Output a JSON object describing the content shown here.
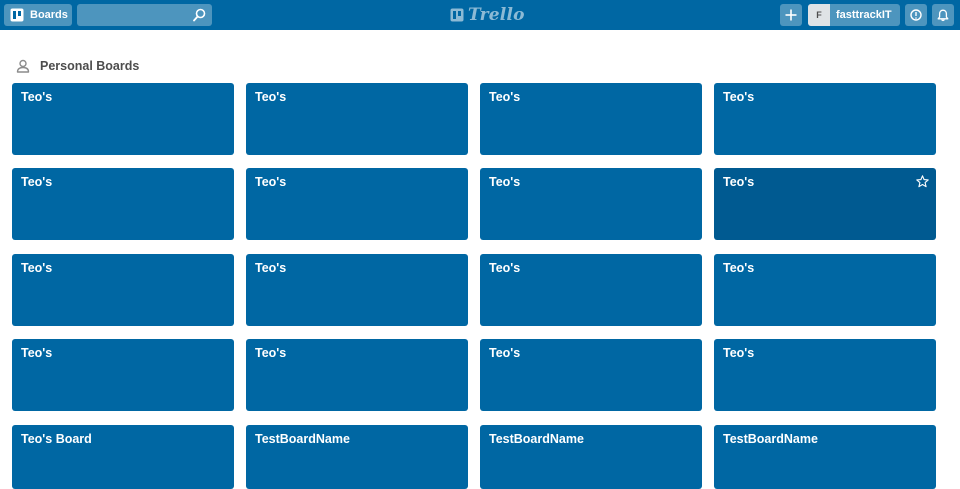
{
  "header": {
    "boards_label": "Boards",
    "search": {
      "value": "",
      "placeholder": ""
    },
    "logo_text": "Trello",
    "member": {
      "initial": "F",
      "name": "fasttrackIT"
    }
  },
  "section": {
    "title": "Personal Boards"
  },
  "boards": [
    "Teo's",
    "Teo's",
    "Teo's",
    "Teo's",
    "Teo's",
    "Teo's",
    "Teo's",
    "Teo's",
    "Teo's",
    "Teo's",
    "Teo's",
    "Teo's",
    "Teo's",
    "Teo's",
    "Teo's",
    "Teo's",
    "Teo's Board",
    "TestBoardName",
    "TestBoardName",
    "TestBoardName"
  ],
  "colors": {
    "header": "#0067a3",
    "tile": "#0067a3",
    "tile_hover": "#005a91"
  }
}
